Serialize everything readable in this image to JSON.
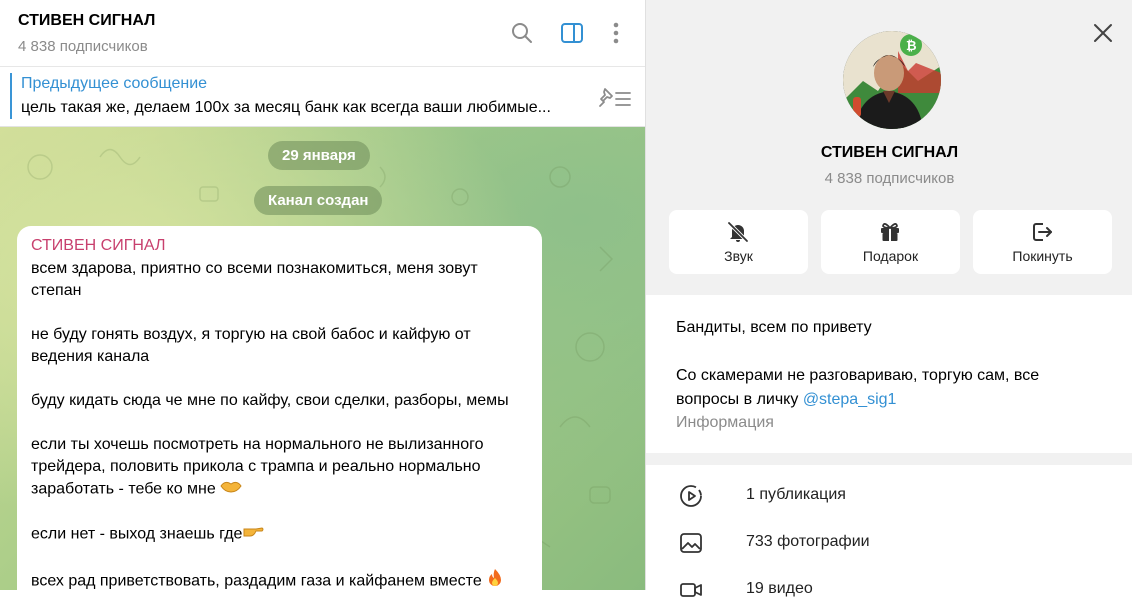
{
  "chat": {
    "title": "СТИВЕН СИГНАЛ",
    "subtitle": "4 838 подписчиков",
    "pinned": {
      "title": "Предыдущее сообщение",
      "text": "цель такая же, делаем 100х за месяц банк как всегда ваши любимые..."
    },
    "date_label": "29 января",
    "service_label": "Канал создан",
    "message": {
      "author": "СТИВЕН СИГНАЛ",
      "paragraphs": [
        "всем здарова, приятно со всеми познакомиться, меня зовут степан",
        "не буду гонять воздух, я торгую на свой бабос и кайфую от ведения канала",
        "буду кидать сюда че мне по кайфу, свои сделки, разборы, мемы",
        "если ты хочешь посмотреть на нормального не вылизанного трейдера, половить прикола с трампа и реально нормально заработать - тебе ко мне",
        "если нет - выход знаешь где",
        "всех рад приветствовать, раздадим газа и кайфанем вместе"
      ]
    }
  },
  "info": {
    "title": "СТИВЕН СИГНАЛ",
    "subtitle": "4 838 подписчиков",
    "actions": {
      "sound": "Звук",
      "gift": "Подарок",
      "leave": "Покинуть"
    },
    "about": {
      "line1": "Бандиты, всем по привету",
      "line2": "Со скамерами не разговариваю, торгую сам, все вопросы в личку ",
      "link": "@stepa_sig1",
      "caption": "Информация"
    },
    "stats": {
      "posts": "1 публикация",
      "photos": "733 фотографии",
      "videos": "19 видео"
    }
  },
  "colors": {
    "accent": "#3390d3",
    "author": "#c8406e",
    "muted": "#8b8b8b"
  },
  "icons": [
    "search-icon",
    "sidebar-toggle-icon",
    "more-vertical-icon",
    "pinned-list-icon",
    "close-icon",
    "bell-off-icon",
    "gift-icon",
    "logout-icon",
    "play-circle-icon",
    "photo-icon",
    "video-icon",
    "handshake-emoji",
    "pointing-right-emoji",
    "fire-emoji"
  ]
}
